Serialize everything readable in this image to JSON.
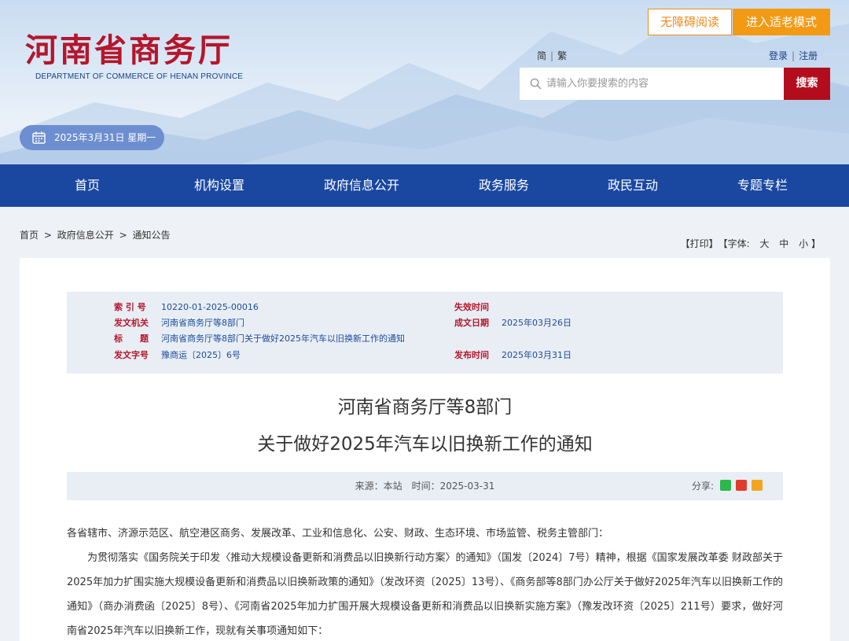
{
  "header": {
    "logo_cn": "河南省商务厅",
    "logo_en": "DEPARTMENT OF COMMERCE OF HENAN PROVINCE",
    "accessible_read": "无障碍阅读",
    "elder_mode": "进入适老模式",
    "lang_simplified": "简",
    "lang_separator": "|",
    "lang_traditional": "繁",
    "login": "登录",
    "register": "注册",
    "search_placeholder": "请输入你要搜索的内容",
    "search_button": "搜索",
    "date": "2025年3月31日 星期一"
  },
  "nav": {
    "items": [
      "首页",
      "机构设置",
      "政府信息公开",
      "政务服务",
      "政民互动",
      "专题专栏"
    ]
  },
  "breadcrumb": {
    "items": [
      "首页",
      "政府信息公开",
      "通知公告"
    ],
    "separator": ">"
  },
  "tools": {
    "print": "【打印】",
    "font_label": "【字体:",
    "large": "大",
    "medium": "中",
    "small": "小",
    "close": "】"
  },
  "meta": {
    "index_label": "索 引 号",
    "index_value": "10220-01-2025-00016",
    "issuer_label": "发文机关",
    "issuer_value": "河南省商务厅等8部门",
    "title_label": "标　　题",
    "title_value": "河南省商务厅等8部门关于做好2025年汽车以旧换新工作的通知",
    "docno_label": "发文字号",
    "docno_value": "豫商运〔2025〕6号",
    "expire_label": "失效时间",
    "expire_value": "",
    "created_label": "成文日期",
    "created_value": "2025年03月26日",
    "published_label": "发布时间",
    "published_value": "2025年03月31日"
  },
  "article": {
    "title_line1": "河南省商务厅等8部门",
    "title_line2": "关于做好2025年汽车以旧换新工作的通知",
    "source_text": "来源：本站　时间：2025-03-31",
    "share_label": "分享:",
    "salutation": "各省辖市、济源示范区、航空港区商务、发展改革、工业和信息化、公安、财政、生态环境、市场监管、税务主管部门：",
    "paragraph1": "为贯彻落实《国务院关于印发〈推动大规模设备更新和消费品以旧换新行动方案〉的通知》（国发〔2024〕7号）精神，根据《国家发展改革委 财政部关于2025年加力扩围实施大规模设备更新和消费品以旧换新政策的通知》（发改环资〔2025〕13号）、《商务部等8部门办公厅关于做好2025年汽车以旧换新工作的通知》（商办消费函〔2025〕8号）、《河南省2025年加力扩围开展大规模设备更新和消费品以旧换新实施方案》（豫发改环资〔2025〕211号）要求，做好河南省2025年汽车以旧换新工作，现就有关事项通知如下："
  },
  "colors": {
    "nav_bg": "#1a48a1",
    "brand_red": "#b5162b",
    "accent_orange": "#f39a14",
    "search_red": "#b30d1d",
    "date_pill": "#6d8fd1"
  }
}
